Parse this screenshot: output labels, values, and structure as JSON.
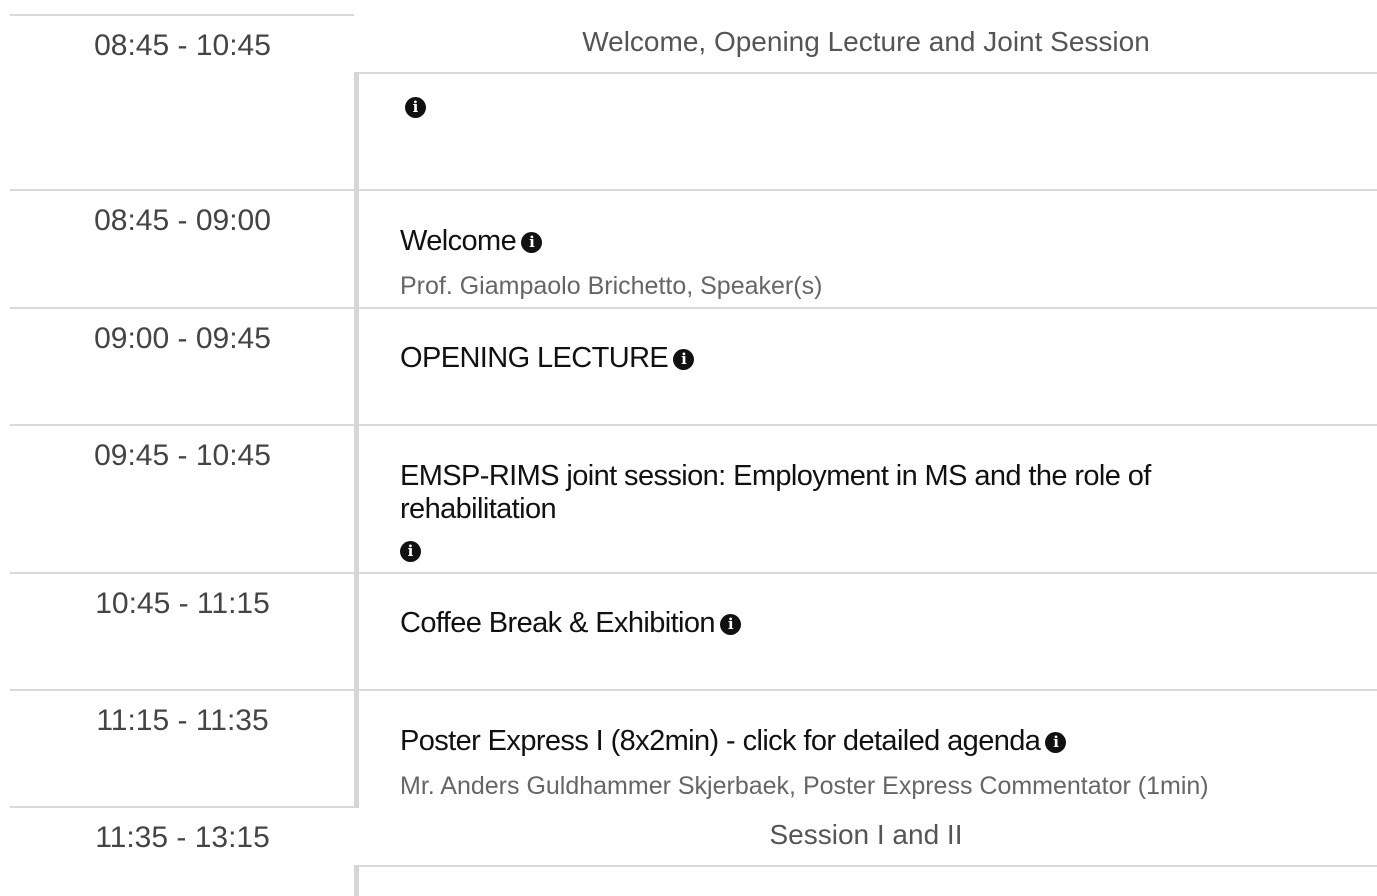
{
  "info_glyph": "i",
  "groups": [
    {
      "time": "08:45 - 10:45",
      "title": "Welcome, Opening Lecture and Joint Session"
    },
    {
      "time": "11:35 - 13:15",
      "title": "Session I and II"
    }
  ],
  "entries": [
    {
      "time": "08:45 - 09:00",
      "title": "Welcome",
      "subtitle": "Prof. Giampaolo Brichetto, Speaker(s)"
    },
    {
      "time": "09:00 - 09:45",
      "title": "OPENING LECTURE"
    },
    {
      "time": "09:45 - 10:45",
      "title": "EMSP-RIMS joint session: Employment in MS and the role of rehabilitation"
    },
    {
      "time": "10:45 - 11:15",
      "title": "Coffee Break & Exhibition"
    },
    {
      "time": "11:15 - 11:35",
      "title": "Poster Express I (8x2min) - click for detailed agenda",
      "subtitle": "Mr. Anders Guldhammer Skjerbaek, Poster Express Commentator (1min)"
    }
  ]
}
